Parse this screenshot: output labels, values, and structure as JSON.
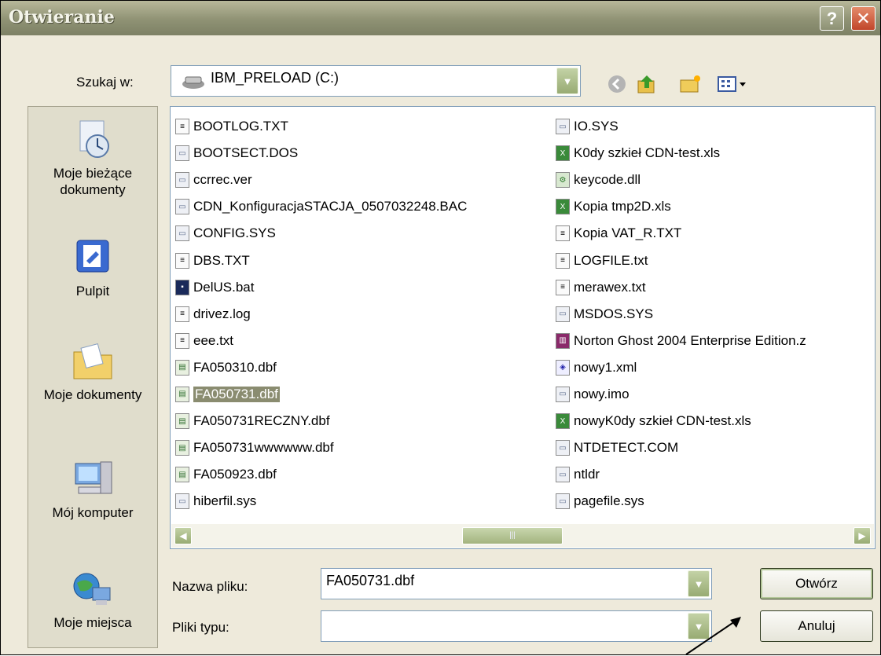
{
  "window": {
    "title": "Otwieranie",
    "help_label": "?",
    "close_label": "✕"
  },
  "lookin": {
    "label": "Szukaj w:",
    "value": "IBM_PRELOAD (C:)"
  },
  "places": [
    {
      "label": "Moje bieżące dokumenty",
      "icon": "recent-documents-icon"
    },
    {
      "label": "Pulpit",
      "icon": "desktop-icon"
    },
    {
      "label": "Moje dokumenty",
      "icon": "my-documents-icon"
    },
    {
      "label": "Mój komputer",
      "icon": "my-computer-icon"
    },
    {
      "label": "Moje miejsca",
      "icon": "network-places-icon"
    }
  ],
  "files_left": [
    {
      "name": "BOOTLOG.TXT",
      "type": "txt"
    },
    {
      "name": "BOOTSECT.DOS",
      "type": "sys"
    },
    {
      "name": "ccrrec.ver",
      "type": "sys"
    },
    {
      "name": "CDN_KonfiguracjaSTACJA_0507032248.BAC",
      "type": "sys"
    },
    {
      "name": "CONFIG.SYS",
      "type": "sys"
    },
    {
      "name": "DBS.TXT",
      "type": "txt"
    },
    {
      "name": "DelUS.bat",
      "type": "bat"
    },
    {
      "name": "drivez.log",
      "type": "txt"
    },
    {
      "name": "eee.txt",
      "type": "txt"
    },
    {
      "name": "FA050310.dbf",
      "type": "dbf"
    },
    {
      "name": "FA050731.dbf",
      "type": "dbf",
      "selected": true
    },
    {
      "name": "FA050731RECZNY.dbf",
      "type": "dbf"
    },
    {
      "name": "FA050731wwwwww.dbf",
      "type": "dbf"
    },
    {
      "name": "FA050923.dbf",
      "type": "dbf"
    },
    {
      "name": "hiberfil.sys",
      "type": "sys"
    }
  ],
  "files_right": [
    {
      "name": "IO.SYS",
      "type": "sys"
    },
    {
      "name": "K0dy szkieł CDN-test.xls",
      "type": "xls"
    },
    {
      "name": "keycode.dll",
      "type": "dll"
    },
    {
      "name": "Kopia tmp2D.xls",
      "type": "xls"
    },
    {
      "name": "Kopia VAT_R.TXT",
      "type": "txt"
    },
    {
      "name": "LOGFILE.txt",
      "type": "txt"
    },
    {
      "name": "merawex.txt",
      "type": "txt"
    },
    {
      "name": "MSDOS.SYS",
      "type": "sys"
    },
    {
      "name": "Norton Ghost 2004 Enterprise Edition.z",
      "type": "zip"
    },
    {
      "name": "nowy1.xml",
      "type": "xml"
    },
    {
      "name": "nowy.imo",
      "type": "sys"
    },
    {
      "name": "nowyK0dy szkieł CDN-test.xls",
      "type": "xls"
    },
    {
      "name": "NTDETECT.COM",
      "type": "sys"
    },
    {
      "name": "ntldr",
      "type": "sys"
    },
    {
      "name": "pagefile.sys",
      "type": "sys"
    }
  ],
  "filename": {
    "label": "Nazwa pliku:",
    "value": "FA050731.dbf"
  },
  "filetype": {
    "label": "Pliki typu:",
    "value": ""
  },
  "buttons": {
    "open": "Otwórz",
    "cancel": "Anuluj"
  },
  "colors": {
    "titlebar": "#8f9274",
    "selection": "#8a8c70",
    "combo_arrow": "#98ab73"
  }
}
